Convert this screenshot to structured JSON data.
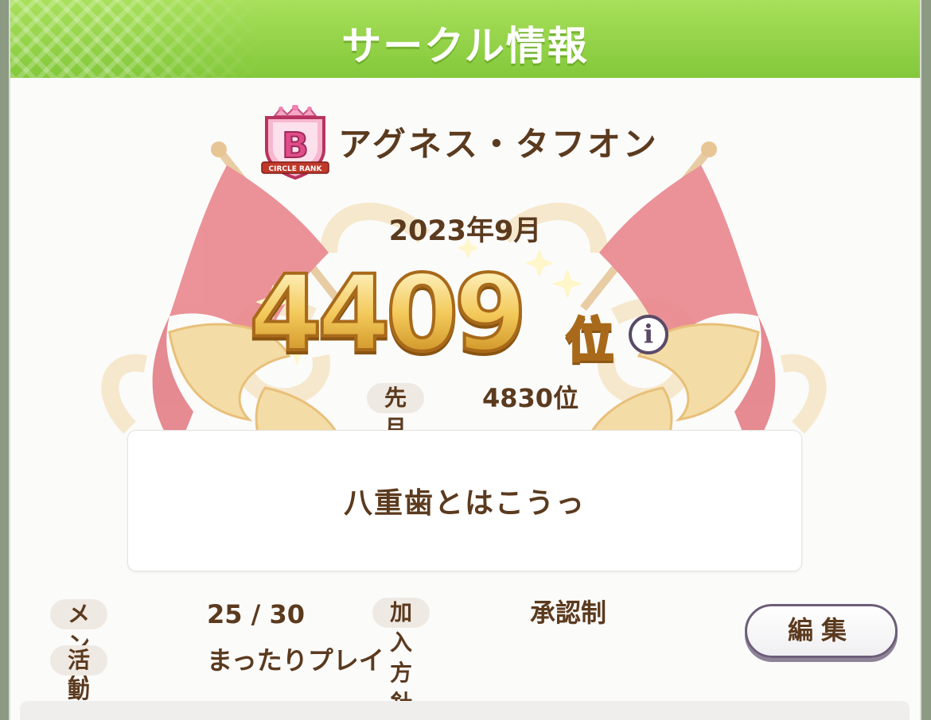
{
  "header": {
    "title": "サークル情報"
  },
  "circle": {
    "rank_letter": "B",
    "rank_caption": "CIRCLE RANK",
    "name": "アグネス・タフオン"
  },
  "ranking": {
    "month": "2023年9月",
    "current_rank": "4409",
    "rank_unit": "位",
    "info_icon": "i",
    "last_month_label": "先月",
    "last_month_value": "4830位"
  },
  "motto": "八重歯とはこうっ",
  "stats": {
    "members_label": "メンバー",
    "members_value": "25 / 30",
    "join_policy_label": "加入方針",
    "join_policy_value": "承認制",
    "activity_label": "活動方針",
    "activity_value": "まったりプレイ"
  },
  "buttons": {
    "edit_label": "編集"
  },
  "colors": {
    "header_green": "#8fd043",
    "text_brown": "#5b3a1e",
    "gold": "#e8b84c",
    "pink_badge": "#e86a9a"
  }
}
